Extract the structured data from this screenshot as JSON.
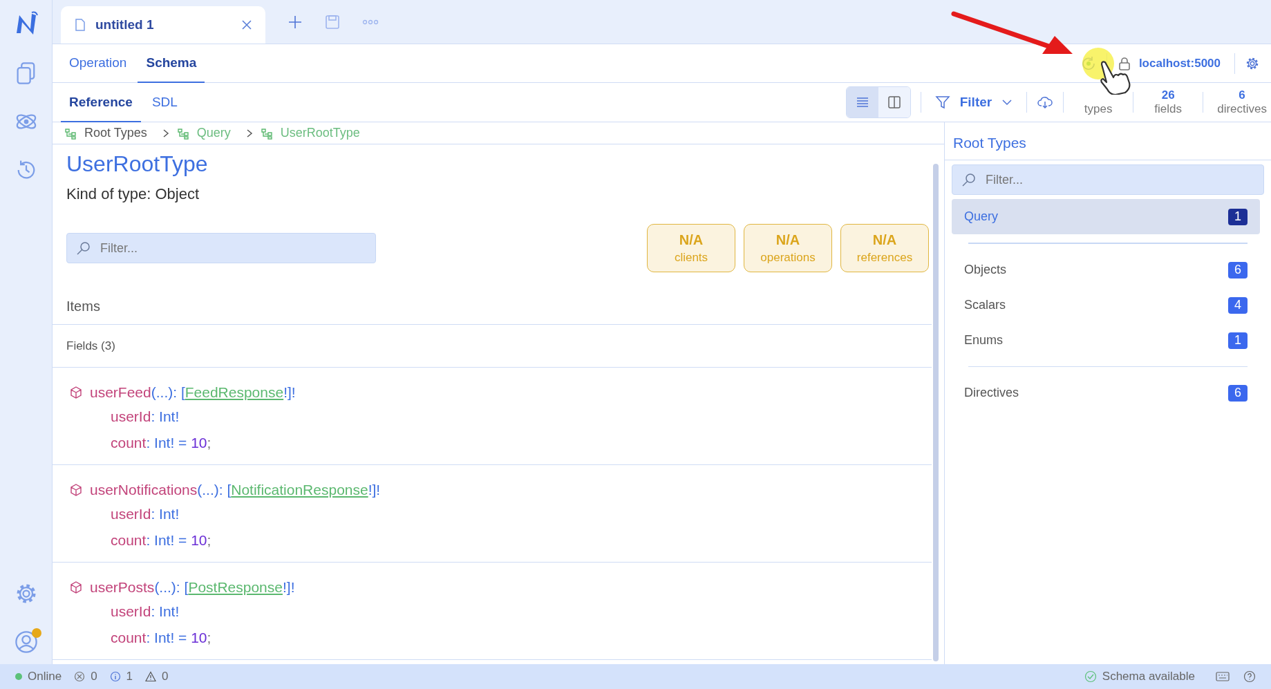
{
  "document_tabs": [
    {
      "label": "untitled 1",
      "selected": true
    }
  ],
  "mode_tabs": [
    {
      "label": "Operation",
      "selected": false
    },
    {
      "label": "Schema",
      "selected": true
    }
  ],
  "endpoint": {
    "host": "localhost:5000"
  },
  "view_tabs": [
    {
      "label": "Reference",
      "selected": true
    },
    {
      "label": "SDL",
      "selected": false
    }
  ],
  "toolbar": {
    "layouts": [
      {
        "kind": "list",
        "selected": true
      },
      {
        "kind": "split",
        "selected": false
      }
    ],
    "filter_label": "Filter",
    "stats": [
      {
        "label": "types"
      },
      {
        "value": "26",
        "label": "fields"
      },
      {
        "value": "6",
        "label": "directives"
      }
    ]
  },
  "breadcrumb": [
    {
      "label": "Root Types"
    },
    {
      "label": "Query"
    },
    {
      "label": "UserRootType"
    }
  ],
  "type_view": {
    "title": "UserRootType",
    "subtitle": "Kind of type: Object",
    "filter_placeholder": "Filter...",
    "metrics": [
      {
        "value": "N/A",
        "label": "clients"
      },
      {
        "value": "N/A",
        "label": "operations"
      },
      {
        "value": "N/A",
        "label": "references"
      }
    ],
    "section": "Items",
    "group": "Fields (3)",
    "fields": [
      {
        "name": "userFeed",
        "args": "(...)",
        "sep": ": [",
        "type": "FeedResponse",
        "suffix": "!]!",
        "arguments": [
          {
            "name": "userId",
            "sep": ":",
            "type": "Int!"
          },
          {
            "name": "count",
            "sep": ":",
            "type": "Int!",
            "eq": "=",
            "default": "10",
            "end": ";"
          }
        ]
      },
      {
        "name": "userNotifications",
        "args": "(...)",
        "sep": ": [",
        "type": "NotificationResponse",
        "suffix": "!]!",
        "arguments": [
          {
            "name": "userId",
            "sep": ":",
            "type": "Int!"
          },
          {
            "name": "count",
            "sep": ":",
            "type": "Int!",
            "eq": "=",
            "default": "10",
            "end": ";"
          }
        ]
      },
      {
        "name": "userPosts",
        "args": "(...)",
        "sep": ": [",
        "type": "PostResponse",
        "suffix": "!]!",
        "arguments": [
          {
            "name": "userId",
            "sep": ":",
            "type": "Int!"
          },
          {
            "name": "count",
            "sep": ":",
            "type": "Int!",
            "eq": "=",
            "default": "10",
            "end": ";"
          }
        ]
      }
    ]
  },
  "side_panel": {
    "title": "Root Types",
    "filter_placeholder": "Filter...",
    "groups": [
      [
        {
          "label": "Query",
          "count": "1",
          "selected": true
        }
      ],
      [
        {
          "label": "Objects",
          "count": "6",
          "selected": false
        },
        {
          "label": "Scalars",
          "count": "4",
          "selected": false
        },
        {
          "label": "Enums",
          "count": "1",
          "selected": false
        }
      ],
      [
        {
          "label": "Directives",
          "count": "6",
          "selected": false
        }
      ]
    ]
  },
  "status_bar": {
    "connection": {
      "label": "Online",
      "color": "#5cc17a"
    },
    "errors": "0",
    "infos": "1",
    "warnings": "0",
    "schema": "Schema available"
  },
  "user": {
    "notification": true
  }
}
